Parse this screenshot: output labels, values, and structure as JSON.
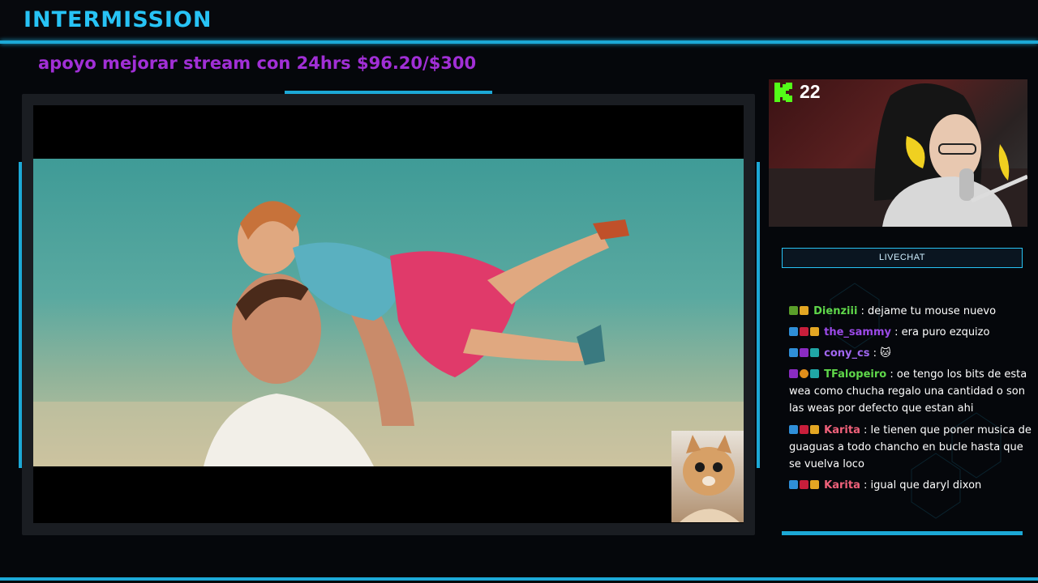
{
  "header": {
    "title": "INTERMISSION"
  },
  "goal": {
    "text": "apoyo mejorar stream con 24hrs $96.20/$300"
  },
  "webcam": {
    "viewer_count": "22",
    "platform_icon": "kick-icon"
  },
  "chat": {
    "header_label": "LIVECHAT",
    "messages": [
      {
        "user": "Dienziii",
        "color": "#5fd74a",
        "text": ": dejame tu mouse nuevo",
        "badges": [
          "green",
          "gold"
        ]
      },
      {
        "user": "the_sammy",
        "color": "#9b4ae8",
        "text": ": era puro ezquizo",
        "badges": [
          "blue",
          "red",
          "gold"
        ]
      },
      {
        "user": "cony_cs",
        "color": "#a066f0",
        "text": ": 🐱",
        "badges": [
          "blue",
          "purple",
          "teal"
        ]
      },
      {
        "user": "TFalopeiro",
        "color": "#5fd74a",
        "text": ": oe tengo los bits de esta wea como chucha regalo una cantidad o son las weas por defecto que estan ahi",
        "badges": [
          "purple",
          "orange",
          "teal"
        ]
      },
      {
        "user": "Karita",
        "color": "#f0617a",
        "text": ": le tienen que poner musica de guaguas a todo chancho en bucle hasta que se vuelva loco",
        "badges": [
          "blue",
          "red",
          "gold"
        ]
      },
      {
        "user": "Karita",
        "color": "#f0617a",
        "text": ": igual que daryl dixon",
        "badges": [
          "blue",
          "red",
          "gold"
        ]
      }
    ]
  },
  "colors": {
    "accent": "#1ca8d6",
    "goal": "#a12fd6",
    "kick_green": "#53fc18"
  }
}
